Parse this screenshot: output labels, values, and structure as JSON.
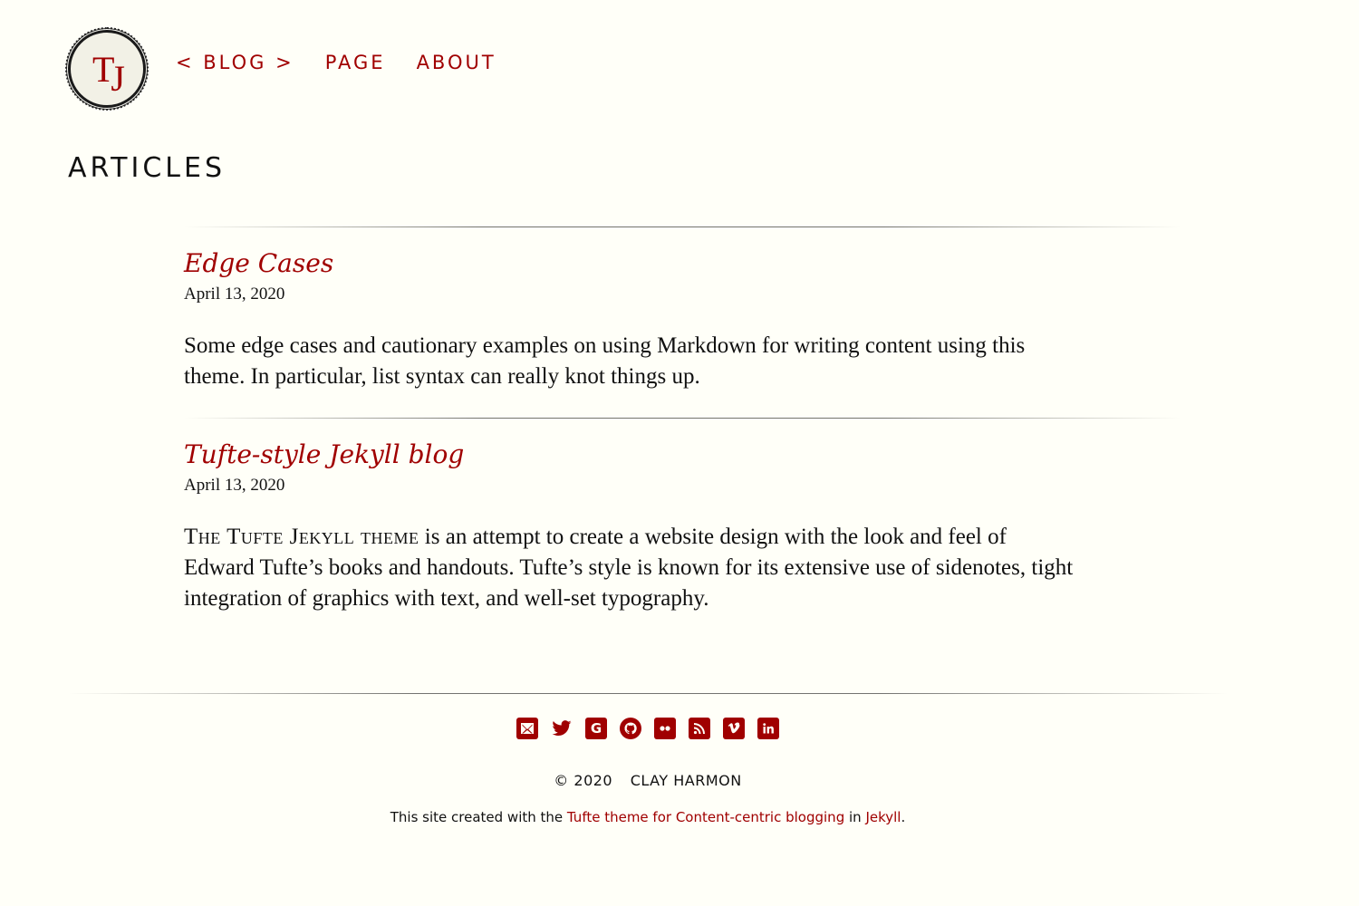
{
  "header": {
    "logo_text_t": "T",
    "logo_text_j": "J",
    "nav": [
      {
        "label": "< BLOG >"
      },
      {
        "label": "PAGE"
      },
      {
        "label": "ABOUT"
      }
    ]
  },
  "page": {
    "title": "ARTICLES"
  },
  "articles": [
    {
      "title": "Edge Cases",
      "date": "April 13, 2020",
      "excerpt": "Some edge cases and cautionary examples on using Markdown for writing content using this theme. In particular, list syntax can really knot things up."
    },
    {
      "title": "Tufte-style Jekyll blog",
      "date": "April 13, 2020",
      "excerpt_smallcaps": "The Tufte Jekyll theme",
      "excerpt": " is an attempt to create a website design with the look and feel of Edward Tufte’s books and handouts. Tufte’s style is known for its extensive use of sidenotes, tight integration of graphics with text, and well-set typography."
    }
  ],
  "footer": {
    "social_icons": [
      "email-icon",
      "twitter-icon",
      "google-icon",
      "github-icon",
      "flickr-icon",
      "rss-icon",
      "vimeo-icon",
      "linkedin-icon"
    ],
    "copyright_year": "© 2020",
    "copyright_name": "CLAY HARMON",
    "credit_prefix": "This site created with the ",
    "credit_link1": "Tufte theme for Content-centric blogging ",
    "credit_mid": " in ",
    "credit_link2": "Jekyll",
    "credit_suffix": "."
  },
  "colors": {
    "accent": "#a00000",
    "background": "#fffff8",
    "text": "#111111"
  }
}
